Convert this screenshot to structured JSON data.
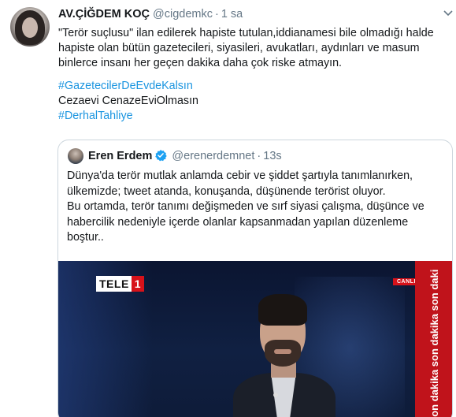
{
  "tweet": {
    "author_name": "AV.ÇİĞDEM KOÇ",
    "author_handle": "@cigdemkc",
    "separator": "·",
    "time": "1 sa",
    "lines": [
      "\"Terör suçlusu\" ilan edilerek hapiste tutulan,iddianamesi bile olmadığı halde",
      "hapiste olan bütün gazetecileri, siyasileri, avukatları, aydınları ve masum",
      "binlerce insanı her geçen dakika daha çok riske atmayın."
    ],
    "hashtag_1": "#GazetecilerDeEvdeKalsın",
    "plain_line": "Cezaevi CenazeEviOlmasın",
    "hashtag_2": "#DerhalTahliye"
  },
  "quoted_tweet": {
    "author_name": "Eren Erdem",
    "verified_icon": "verified-badge-icon",
    "author_handle": "@erenerdemnet",
    "separator": "·",
    "time": "13s",
    "lines": [
      "Dünya'da terör mutlak anlamda cebir ve şiddet şartıyla tanımlanırken,",
      "ülkemizde;  tweet atanda, konuşanda, düşünende terörist oluyor.",
      "Bu ortamda, terör tanımı değişmeden ve sırf siyasi çalışma, düşünce ve",
      "habercilik nedeniyle içerde olanlar kapsanmadan yapılan düzenleme",
      "boştur.."
    ],
    "media": {
      "channel_logo_part1": "TELE",
      "channel_logo_part2": "1",
      "live_badge": "CANLI",
      "banner_text": "son dakika  son dakika  son daki"
    }
  },
  "colors": {
    "link": "#1b95e0",
    "secondary_text": "#657786",
    "border": "#ccd6dd",
    "verified": "#1da1f2",
    "banner_red": "#c0131b"
  }
}
